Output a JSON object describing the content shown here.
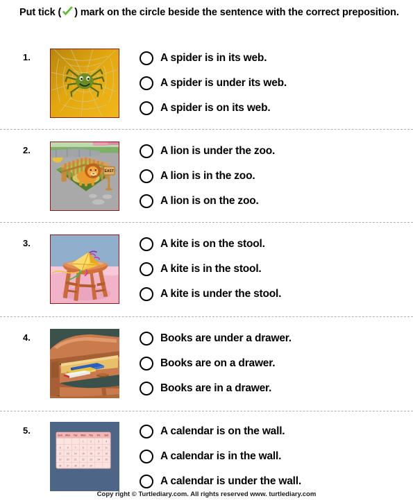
{
  "instruction": {
    "before_tick": "Put tick (",
    "tick_icon": "green-check-icon",
    "after_tick": ") mark on the circle beside the sentence with the correct preposition."
  },
  "questions": [
    {
      "number": "1.",
      "image": {
        "name": "spider-on-web-image",
        "alt": "A green spider sitting on a web with an orange background",
        "framed": true
      },
      "options": [
        "A spider is in its web.",
        "A spider is under its web.",
        "A spider is on its web."
      ]
    },
    {
      "number": "2.",
      "image": {
        "name": "lion-in-zoo-image",
        "alt": "A lion inside a wooden fenced zoo enclosure with an East sign",
        "framed": true,
        "sign_label": "EAST"
      },
      "options": [
        "A lion is under the zoo.",
        "A lion is in the zoo.",
        "A lion is on the zoo."
      ]
    },
    {
      "number": "3.",
      "image": {
        "name": "kite-on-stool-image",
        "alt": "A yellow kite resting on a wooden stool",
        "framed": true
      },
      "options": [
        "A kite is on the stool.",
        "A kite is in the stool.",
        "A kite is under the stool."
      ]
    },
    {
      "number": "4.",
      "image": {
        "name": "books-in-drawer-image",
        "alt": "Books inside an open desk drawer",
        "framed": false
      },
      "options": [
        "Books are under a drawer.",
        "Books are on a drawer.",
        "Books are in a drawer."
      ]
    },
    {
      "number": "5.",
      "image": {
        "name": "calendar-on-wall-image",
        "alt": "A pink calendar hanging on a blue-grey wall",
        "framed": false,
        "day_headers": [
          "Sun",
          "Mon",
          "Tue",
          "Wed",
          "Thu",
          "Fri",
          "Sat"
        ],
        "dates": [
          [
            "",
            "",
            "",
            "1",
            "2",
            "3",
            "4"
          ],
          [
            "5",
            "6",
            "7",
            "8",
            "9",
            "10",
            "11"
          ],
          [
            "12",
            "13",
            "14",
            "15",
            "16",
            "17",
            "18"
          ],
          [
            "19",
            "20",
            "21",
            "22",
            "23",
            "24",
            "25"
          ],
          [
            "26",
            "27",
            "28",
            "29",
            "30",
            "",
            ""
          ]
        ]
      },
      "options": [
        "A calendar is on the wall.",
        "A calendar is in the wall.",
        "A calendar is under the wall."
      ]
    }
  ],
  "footer": "Copy right © Turtlediary.com. All rights reserved   www. turtlediary.com",
  "colors": {
    "tick_green": "#5FBB2E",
    "image_frame": "#8B1A1A",
    "divider": "#b0b0b0",
    "spider_bg": "#E8A317",
    "zoo_ground": "#A8A8A8",
    "stool_wall": "#8FAFCC",
    "drawer_bg": "#3A514C",
    "wall_blue": "#4D6687"
  }
}
